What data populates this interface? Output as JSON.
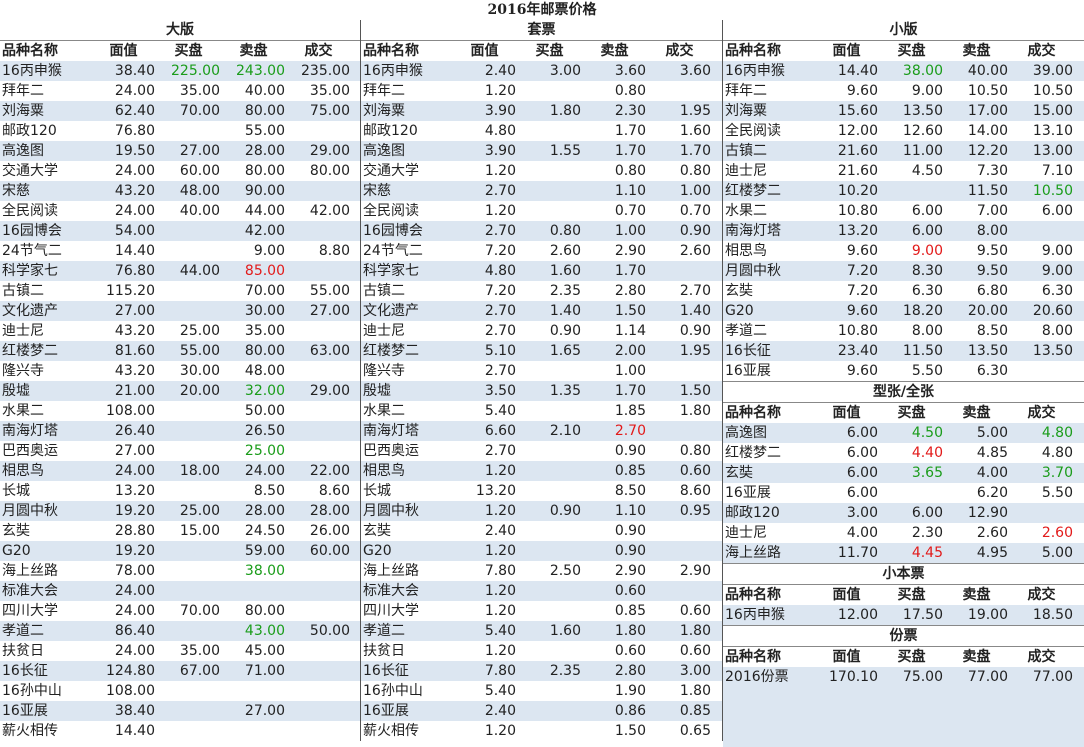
{
  "title": "2016年邮票价格",
  "headers": [
    "品种名称",
    "面值",
    "买盘",
    "卖盘",
    "成交"
  ],
  "colors": {
    "up": "#1a9c1a",
    "down": "#e21a1a",
    "stripe": "#dce6f1"
  },
  "sections": {
    "dabian": {
      "title": "大版",
      "rows": [
        {
          "name": "16丙申猴",
          "face": "38.40",
          "bid": "225.00",
          "ask": "243.00",
          "deal": "235.00",
          "bid_color": "green",
          "ask_color": "green"
        },
        {
          "name": "拜年二",
          "face": "24.00",
          "bid": "35.00",
          "ask": "40.00",
          "deal": "35.00"
        },
        {
          "name": "刘海粟",
          "face": "62.40",
          "bid": "70.00",
          "ask": "80.00",
          "deal": "75.00"
        },
        {
          "name": "邮政120",
          "face": "76.80",
          "bid": "",
          "ask": "55.00",
          "deal": ""
        },
        {
          "name": "高逸图",
          "face": "19.50",
          "bid": "27.00",
          "ask": "28.00",
          "deal": "29.00"
        },
        {
          "name": "交通大学",
          "face": "24.00",
          "bid": "60.00",
          "ask": "80.00",
          "deal": "80.00"
        },
        {
          "name": "宋慈",
          "face": "43.20",
          "bid": "48.00",
          "ask": "90.00",
          "deal": ""
        },
        {
          "name": "全民阅读",
          "face": "24.00",
          "bid": "40.00",
          "ask": "44.00",
          "deal": "42.00"
        },
        {
          "name": "16园博会",
          "face": "54.00",
          "bid": "",
          "ask": "42.00",
          "deal": ""
        },
        {
          "name": "24节气二",
          "face": "14.40",
          "bid": "",
          "ask": "9.00",
          "deal": "8.80"
        },
        {
          "name": "科学家七",
          "face": "76.80",
          "bid": "44.00",
          "ask": "85.00",
          "deal": "",
          "ask_color": "red"
        },
        {
          "name": "古镇二",
          "face": "115.20",
          "bid": "",
          "ask": "70.00",
          "deal": "55.00"
        },
        {
          "name": "文化遗产",
          "face": "27.00",
          "bid": "",
          "ask": "30.00",
          "deal": "27.00"
        },
        {
          "name": "迪士尼",
          "face": "43.20",
          "bid": "25.00",
          "ask": "35.00",
          "deal": ""
        },
        {
          "name": "红楼梦二",
          "face": "81.60",
          "bid": "55.00",
          "ask": "80.00",
          "deal": "63.00"
        },
        {
          "name": "隆兴寺",
          "face": "43.20",
          "bid": "30.00",
          "ask": "48.00",
          "deal": ""
        },
        {
          "name": "殷墟",
          "face": "21.00",
          "bid": "20.00",
          "ask": "32.00",
          "deal": "29.00",
          "ask_color": "green"
        },
        {
          "name": "水果二",
          "face": "108.00",
          "bid": "",
          "ask": "50.00",
          "deal": ""
        },
        {
          "name": "南海灯塔",
          "face": "26.40",
          "bid": "",
          "ask": "26.50",
          "deal": ""
        },
        {
          "name": "巴西奥运",
          "face": "27.00",
          "bid": "",
          "ask": "25.00",
          "deal": "",
          "ask_color": "green"
        },
        {
          "name": "相思鸟",
          "face": "24.00",
          "bid": "18.00",
          "ask": "24.00",
          "deal": "22.00"
        },
        {
          "name": "长城",
          "face": "13.20",
          "bid": "",
          "ask": "8.50",
          "deal": "8.60"
        },
        {
          "name": "月圆中秋",
          "face": "19.20",
          "bid": "25.00",
          "ask": "28.00",
          "deal": "28.00"
        },
        {
          "name": "玄奘",
          "face": "28.80",
          "bid": "15.00",
          "ask": "24.50",
          "deal": "26.00"
        },
        {
          "name": "G20",
          "face": "19.20",
          "bid": "",
          "ask": "59.00",
          "deal": "60.00"
        },
        {
          "name": "海上丝路",
          "face": "78.00",
          "bid": "",
          "ask": "38.00",
          "deal": "",
          "ask_color": "green"
        },
        {
          "name": "标准大会",
          "face": "24.00",
          "bid": "",
          "ask": "",
          "deal": ""
        },
        {
          "name": "四川大学",
          "face": "24.00",
          "bid": "70.00",
          "ask": "80.00",
          "deal": ""
        },
        {
          "name": "孝道二",
          "face": "86.40",
          "bid": "",
          "ask": "43.00",
          "deal": "50.00",
          "ask_color": "green"
        },
        {
          "name": "扶贫日",
          "face": "24.00",
          "bid": "35.00",
          "ask": "45.00",
          "deal": ""
        },
        {
          "name": "16长征",
          "face": "124.80",
          "bid": "67.00",
          "ask": "71.00",
          "deal": ""
        },
        {
          "name": "16孙中山",
          "face": "108.00",
          "bid": "",
          "ask": "",
          "deal": ""
        },
        {
          "name": "16亚展",
          "face": "38.40",
          "bid": "",
          "ask": "27.00",
          "deal": ""
        },
        {
          "name": "薪火相传",
          "face": "14.40",
          "bid": "",
          "ask": "",
          "deal": ""
        }
      ]
    },
    "taopiao": {
      "title": "套票",
      "rows": [
        {
          "name": "16丙申猴",
          "face": "2.40",
          "bid": "3.00",
          "ask": "3.60",
          "deal": "3.60"
        },
        {
          "name": "拜年二",
          "face": "1.20",
          "bid": "",
          "ask": "0.80",
          "deal": ""
        },
        {
          "name": "刘海粟",
          "face": "3.90",
          "bid": "1.80",
          "ask": "2.30",
          "deal": "1.95"
        },
        {
          "name": "邮政120",
          "face": "4.80",
          "bid": "",
          "ask": "1.70",
          "deal": "1.60"
        },
        {
          "name": "高逸图",
          "face": "3.90",
          "bid": "1.55",
          "ask": "1.70",
          "deal": "1.70"
        },
        {
          "name": "交通大学",
          "face": "1.20",
          "bid": "",
          "ask": "0.80",
          "deal": "0.80"
        },
        {
          "name": "宋慈",
          "face": "2.70",
          "bid": "",
          "ask": "1.10",
          "deal": "1.00"
        },
        {
          "name": "全民阅读",
          "face": "1.20",
          "bid": "",
          "ask": "0.70",
          "deal": "0.70"
        },
        {
          "name": "16园博会",
          "face": "2.70",
          "bid": "0.80",
          "ask": "1.00",
          "deal": "0.90"
        },
        {
          "name": "24节气二",
          "face": "7.20",
          "bid": "2.60",
          "ask": "2.90",
          "deal": "2.60"
        },
        {
          "name": "科学家七",
          "face": "4.80",
          "bid": "1.60",
          "ask": "1.70",
          "deal": ""
        },
        {
          "name": "古镇二",
          "face": "7.20",
          "bid": "2.35",
          "ask": "2.80",
          "deal": "2.70"
        },
        {
          "name": "文化遗产",
          "face": "2.70",
          "bid": "1.40",
          "ask": "1.50",
          "deal": "1.40"
        },
        {
          "name": "迪士尼",
          "face": "2.70",
          "bid": "0.90",
          "ask": "1.14",
          "deal": "0.90"
        },
        {
          "name": "红楼梦二",
          "face": "5.10",
          "bid": "1.65",
          "ask": "2.00",
          "deal": "1.95"
        },
        {
          "name": "隆兴寺",
          "face": "2.70",
          "bid": "",
          "ask": "1.00",
          "deal": ""
        },
        {
          "name": "殷墟",
          "face": "3.50",
          "bid": "1.35",
          "ask": "1.70",
          "deal": "1.50"
        },
        {
          "name": "水果二",
          "face": "5.40",
          "bid": "",
          "ask": "1.85",
          "deal": "1.80"
        },
        {
          "name": "南海灯塔",
          "face": "6.60",
          "bid": "2.10",
          "ask": "2.70",
          "deal": "",
          "ask_color": "red"
        },
        {
          "name": "巴西奥运",
          "face": "2.70",
          "bid": "",
          "ask": "0.90",
          "deal": "0.80"
        },
        {
          "name": "相思鸟",
          "face": "1.20",
          "bid": "",
          "ask": "0.85",
          "deal": "0.60"
        },
        {
          "name": "长城",
          "face": "13.20",
          "bid": "",
          "ask": "8.50",
          "deal": "8.60"
        },
        {
          "name": "月圆中秋",
          "face": "1.20",
          "bid": "0.90",
          "ask": "1.10",
          "deal": "0.95"
        },
        {
          "name": "玄奘",
          "face": "2.40",
          "bid": "",
          "ask": "0.90",
          "deal": ""
        },
        {
          "name": "G20",
          "face": "1.20",
          "bid": "",
          "ask": "0.90",
          "deal": ""
        },
        {
          "name": "海上丝路",
          "face": "7.80",
          "bid": "2.50",
          "ask": "2.90",
          "deal": "2.90"
        },
        {
          "name": "标准大会",
          "face": "1.20",
          "bid": "",
          "ask": "0.60",
          "deal": ""
        },
        {
          "name": "四川大学",
          "face": "1.20",
          "bid": "",
          "ask": "0.85",
          "deal": "0.60"
        },
        {
          "name": "孝道二",
          "face": "5.40",
          "bid": "1.60",
          "ask": "1.80",
          "deal": "1.80"
        },
        {
          "name": "扶贫日",
          "face": "1.20",
          "bid": "",
          "ask": "0.60",
          "deal": "0.60"
        },
        {
          "name": "16长征",
          "face": "7.80",
          "bid": "2.35",
          "ask": "2.80",
          "deal": "3.00"
        },
        {
          "name": "16孙中山",
          "face": "5.40",
          "bid": "",
          "ask": "1.90",
          "deal": "1.80"
        },
        {
          "name": "16亚展",
          "face": "2.40",
          "bid": "",
          "ask": "0.86",
          "deal": "0.85"
        },
        {
          "name": "薪火相传",
          "face": "1.20",
          "bid": "",
          "ask": "1.50",
          "deal": "0.65"
        }
      ]
    },
    "xiaoban": {
      "title": "小版",
      "rows": [
        {
          "name": "16丙申猴",
          "face": "14.40",
          "bid": "38.00",
          "ask": "40.00",
          "deal": "39.00",
          "bid_color": "green"
        },
        {
          "name": "拜年二",
          "face": "9.60",
          "bid": "9.00",
          "ask": "10.50",
          "deal": "10.50"
        },
        {
          "name": "刘海粟",
          "face": "15.60",
          "bid": "13.50",
          "ask": "17.00",
          "deal": "15.00"
        },
        {
          "name": "全民阅读",
          "face": "12.00",
          "bid": "12.60",
          "ask": "14.00",
          "deal": "13.10"
        },
        {
          "name": "古镇二",
          "face": "21.60",
          "bid": "11.00",
          "ask": "12.20",
          "deal": "13.00"
        },
        {
          "name": "迪士尼",
          "face": "21.60",
          "bid": "4.50",
          "ask": "7.30",
          "deal": "7.10"
        },
        {
          "name": "红楼梦二",
          "face": "10.20",
          "bid": "",
          "ask": "11.50",
          "deal": "10.50",
          "deal_color": "green"
        },
        {
          "name": "水果二",
          "face": "10.80",
          "bid": "6.00",
          "ask": "7.00",
          "deal": "6.00"
        },
        {
          "name": "南海灯塔",
          "face": "13.20",
          "bid": "6.00",
          "ask": "8.00",
          "deal": ""
        },
        {
          "name": "相思鸟",
          "face": "9.60",
          "bid": "9.00",
          "ask": "9.50",
          "deal": "9.00",
          "bid_color": "red"
        },
        {
          "name": "月圆中秋",
          "face": "7.20",
          "bid": "8.30",
          "ask": "9.50",
          "deal": "9.00"
        },
        {
          "name": "玄奘",
          "face": "7.20",
          "bid": "6.30",
          "ask": "6.80",
          "deal": "6.30"
        },
        {
          "name": "G20",
          "face": "9.60",
          "bid": "18.20",
          "ask": "20.00",
          "deal": "20.60"
        },
        {
          "name": "孝道二",
          "face": "10.80",
          "bid": "8.00",
          "ask": "8.50",
          "deal": "8.00"
        },
        {
          "name": "16长征",
          "face": "23.40",
          "bid": "11.50",
          "ask": "13.50",
          "deal": "13.50"
        },
        {
          "name": "16亚展",
          "face": "9.60",
          "bid": "5.50",
          "ask": "6.30",
          "deal": ""
        }
      ]
    },
    "xingzhang": {
      "title": "型张/全张",
      "rows": [
        {
          "name": "高逸图",
          "face": "6.00",
          "bid": "4.50",
          "ask": "5.00",
          "deal": "4.80",
          "bid_color": "green",
          "deal_color": "green"
        },
        {
          "name": "红楼梦二",
          "face": "6.00",
          "bid": "4.40",
          "ask": "4.85",
          "deal": "4.80",
          "bid_color": "red"
        },
        {
          "name": "玄奘",
          "face": "6.00",
          "bid": "3.65",
          "ask": "4.00",
          "deal": "3.70",
          "bid_color": "green",
          "deal_color": "green"
        },
        {
          "name": "16亚展",
          "face": "6.00",
          "bid": "",
          "ask": "6.20",
          "deal": "5.50"
        },
        {
          "name": "邮政120",
          "face": "3.00",
          "bid": "6.00",
          "ask": "12.90",
          "deal": ""
        },
        {
          "name": "迪士尼",
          "face": "4.00",
          "bid": "2.30",
          "ask": "2.60",
          "deal": "2.60",
          "deal_color": "red"
        },
        {
          "name": "海上丝路",
          "face": "11.70",
          "bid": "4.45",
          "ask": "4.95",
          "deal": "5.00",
          "bid_color": "red"
        }
      ]
    },
    "xiaoben": {
      "title": "小本票",
      "rows": [
        {
          "name": "16丙申猴",
          "face": "12.00",
          "bid": "17.50",
          "ask": "19.00",
          "deal": "18.50"
        }
      ]
    },
    "fenpiao": {
      "title": "份票",
      "rows": [
        {
          "name": "2016份票",
          "face": "170.10",
          "bid": "75.00",
          "ask": "77.00",
          "deal": "77.00"
        }
      ]
    }
  }
}
